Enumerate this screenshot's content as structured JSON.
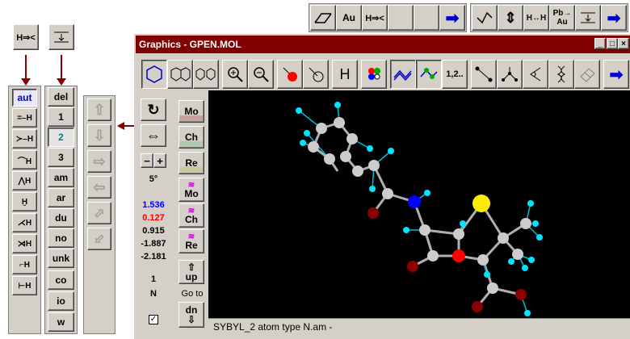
{
  "window": {
    "title": "Graphics - GPEN.MOL",
    "min": "_",
    "max": "□",
    "close": "×"
  },
  "top_toolbar": {
    "au": "Au",
    "hlt": "H⇒<",
    "hh": "H↔H",
    "pbau_1": "Pb→",
    "pbau_2": "Au"
  },
  "left_tools": {
    "h_tool": "H⇒<"
  },
  "hydrogen_list": {
    "active": "aut",
    "items": [
      "=–H",
      "≻–H",
      "⌒H",
      "⋀H",
      "Ḫ",
      "⋌H",
      "⋊H",
      "⌐H",
      "⊢H"
    ]
  },
  "order_list": {
    "items": [
      "del",
      "1",
      "2",
      "3",
      "am",
      "ar",
      "du",
      "no",
      "unk",
      "co",
      "io",
      "w"
    ],
    "selected": "2"
  },
  "toolbar": {
    "h_label": "H",
    "one_two": "1,2.."
  },
  "side_panel": {
    "angle": "5°",
    "value_blue": "1.536",
    "value_red": "0.127",
    "values": [
      "0.915",
      "-1.887",
      "-2.181"
    ],
    "count": "1",
    "element": "N",
    "up_label": "up",
    "goto_label": "Go to",
    "down_label": "dn"
  },
  "mode_buttons": {
    "mo": "Mo",
    "ch": "Ch",
    "re": "Re",
    "mo2": "Mo",
    "ch2": "Ch",
    "re2": "Re"
  },
  "status": {
    "text": "SYBYL_2 atom type N.am -"
  },
  "colors": {
    "titlebar": "#800000",
    "blue_value": "#0000ff",
    "red_value": "#ff0000",
    "arrow": "#8b0000"
  }
}
